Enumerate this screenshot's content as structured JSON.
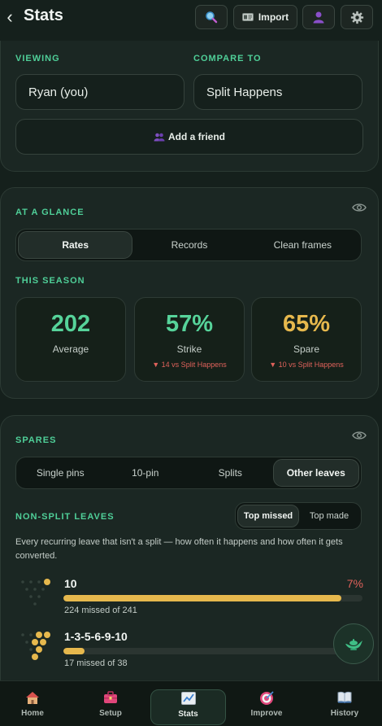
{
  "header": {
    "back_icon": "chevron-left-icon",
    "back_glyph": "‹",
    "title": "Stats",
    "import_label": "Import"
  },
  "compare": {
    "viewing_label": "VIEWING",
    "compare_label": "COMPARE TO",
    "viewing_value": "Ryan (you)",
    "compare_value": "Split Happens",
    "add_friend_label": "Add a friend"
  },
  "glance": {
    "title": "AT A GLANCE",
    "tabs": [
      "Rates",
      "Records",
      "Clean frames"
    ],
    "active_tab": "Rates",
    "season_label": "THIS SEASON",
    "stats": [
      {
        "value": "202",
        "label": "Average",
        "color": "#56d39a",
        "compare": ""
      },
      {
        "value": "57%",
        "label": "Strike",
        "color": "#56d39a",
        "compare": "▼ 14 vs Split Happens"
      },
      {
        "value": "65%",
        "label": "Spare",
        "color": "#e6b84d",
        "compare": "▼ 10 vs Split Happens"
      }
    ]
  },
  "spares": {
    "title": "SPARES",
    "tabs": [
      "Single pins",
      "10-pin",
      "Splits",
      "Other leaves"
    ],
    "active_tab": "Other leaves",
    "leaves_title": "NON-SPLIT LEAVES",
    "toggle": [
      "Top missed",
      "Top made"
    ],
    "active_toggle": "Top missed",
    "description": "Every recurring leave that isn't a split — how often it happens and how often it gets converted.",
    "leaves": [
      {
        "name": "10",
        "percent": "7%",
        "detail": "224 missed of 241",
        "made_fraction": 0.93,
        "standing": [
          10
        ]
      },
      {
        "name": "1-3-5-6-9-10",
        "percent": "",
        "detail": "17 missed of 38",
        "made_fraction": 0.07,
        "standing": [
          1,
          3,
          5,
          6,
          9,
          10
        ]
      }
    ]
  },
  "nav": {
    "items": [
      {
        "label": "Home",
        "icon": "house-icon"
      },
      {
        "label": "Setup",
        "icon": "toolbox-icon"
      },
      {
        "label": "Stats",
        "icon": "chart-icon"
      },
      {
        "label": "Improve",
        "icon": "target-icon"
      },
      {
        "label": "History",
        "icon": "book-icon"
      }
    ],
    "active": "Stats"
  },
  "colors": {
    "accent": "#4fcf98",
    "gold": "#e6b84d",
    "negative": "#e0625b",
    "background": "#15201c"
  }
}
